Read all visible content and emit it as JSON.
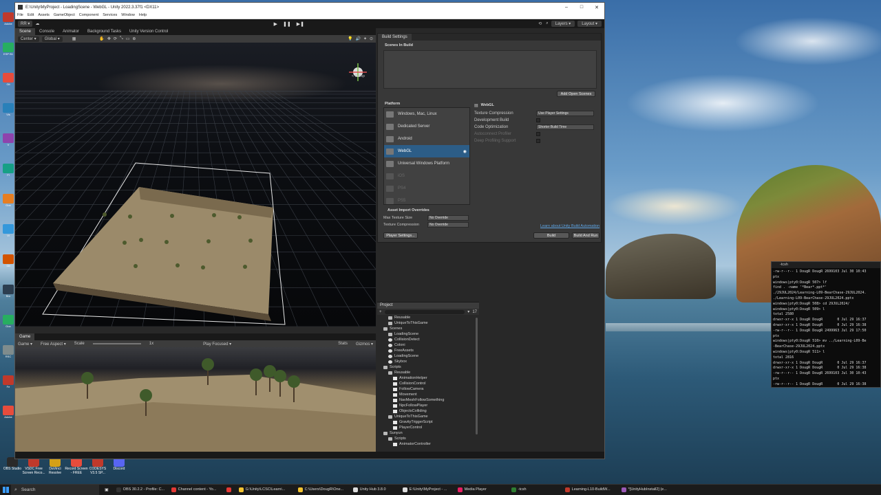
{
  "desktop": {
    "side_icons": [
      "Adobe",
      "ESP B1",
      "Git",
      "Vis",
      "V",
      "Fi",
      "Goo",
      "Vi",
      "Git",
      "Bro",
      "Goo",
      "RSC",
      "Fe",
      "Adobe"
    ],
    "bottom_icons": [
      {
        "label": "OBS Studio",
        "color": "#2a2a2a"
      },
      {
        "label": "VSDC Free Screen Reco...",
        "color": "#c0392b"
      },
      {
        "label": "DaVinci Resolve",
        "color": "#d4a017"
      },
      {
        "label": "Record Screen - FREE",
        "color": "#e74c3c"
      },
      {
        "label": "CODESYS V3.5 SP...",
        "color": "#c0392b"
      },
      {
        "label": "Discord",
        "color": "#5865f2"
      }
    ]
  },
  "unity": {
    "title": "E:\\Unity\\MyProject - LoadingScene - WebGL - Unity 2022.3.37f1 <DX11>",
    "window_controls": [
      "–",
      "□",
      "✕"
    ],
    "menu": [
      "File",
      "Edit",
      "Assets",
      "GameObject",
      "Component",
      "Services",
      "Window",
      "Help"
    ],
    "toolbar": {
      "account": "RR ▾",
      "layers": "Layers ▾",
      "layout": "Layout ▾"
    },
    "scene_tabs": [
      "Scene",
      "Console",
      "Animator",
      "Background Tasks",
      "Unity Version Control"
    ],
    "scene_tools": [
      "Center ▾",
      "Global ▾"
    ],
    "persp_label": "< Persp",
    "game": {
      "tab": "Game",
      "display": "Game ▾",
      "aspect": "Free Aspect ▾",
      "scale_label": "Scale",
      "scale_value": "1x",
      "play_focused": "Play Focused ▾",
      "stats": "Stats",
      "gizmos": "Gizmos ▾"
    },
    "build": {
      "tab": "Build Settings",
      "scenes_in_build": "Scenes In Build",
      "add_open_scenes": "Add Open Scenes",
      "platform_header": "Platform",
      "platforms": [
        {
          "label": "Windows, Mac, Linux",
          "state": "normal"
        },
        {
          "label": "Dedicated Server",
          "state": "normal"
        },
        {
          "label": "Android",
          "state": "normal"
        },
        {
          "label": "WebGL",
          "state": "selected"
        },
        {
          "label": "Universal Windows Platform",
          "state": "normal"
        },
        {
          "label": "iOS",
          "state": "dim"
        },
        {
          "label": "PS4",
          "state": "dim"
        },
        {
          "label": "PS5",
          "state": "dim"
        }
      ],
      "webgl_header": "WebGL",
      "settings": [
        {
          "key": "Texture Compression",
          "value": "Use Player Settings",
          "type": "dropdown"
        },
        {
          "key": "Development Build",
          "value": "",
          "type": "check"
        },
        {
          "key": "Code Optimization",
          "value": "Shorter Build Time",
          "type": "dropdown"
        },
        {
          "key": "Autoconnect Profiler",
          "value": "",
          "type": "check-dim"
        },
        {
          "key": "Deep Profiling Support",
          "value": "",
          "type": "check-dim"
        }
      ],
      "asset_import_overrides": "Asset Import Overrides",
      "max_texture_size": {
        "key": "Max Texture Size",
        "value": "No Override"
      },
      "texture_compression": {
        "key": "Texture Compression",
        "value": "No Override"
      },
      "learn_link": "Learn about Unity Build Automation",
      "player_settings": "Player Settings...",
      "build": "Build",
      "build_and_run": "Build And Run"
    },
    "project": {
      "tab": "Project",
      "count": "17",
      "tree": [
        {
          "label": "Reusable",
          "indent": 2,
          "kind": "folder"
        },
        {
          "label": "UniqueToThisGame",
          "indent": 2,
          "kind": "folder"
        },
        {
          "label": "Scenes",
          "indent": 1,
          "kind": "folder"
        },
        {
          "label": "LoadingScene",
          "indent": 2,
          "kind": "folder"
        },
        {
          "label": "CollisionDetect",
          "indent": 2,
          "kind": "scene"
        },
        {
          "label": "Coloni",
          "indent": 2,
          "kind": "scene"
        },
        {
          "label": "FreeAssets",
          "indent": 2,
          "kind": "scene"
        },
        {
          "label": "LoadingScene",
          "indent": 2,
          "kind": "scene"
        },
        {
          "label": "Skybox",
          "indent": 2,
          "kind": "scene"
        },
        {
          "label": "Scripts",
          "indent": 1,
          "kind": "folder"
        },
        {
          "label": "Reusable",
          "indent": 2,
          "kind": "folder"
        },
        {
          "label": "AnimationHelper",
          "indent": 3,
          "kind": "script"
        },
        {
          "label": "CollisionControl",
          "indent": 3,
          "kind": "script"
        },
        {
          "label": "FollowCamera",
          "indent": 3,
          "kind": "script"
        },
        {
          "label": "Movement",
          "indent": 3,
          "kind": "script"
        },
        {
          "label": "NavMeshFollowSomething",
          "indent": 3,
          "kind": "script"
        },
        {
          "label": "NpcFollowPlayer",
          "indent": 3,
          "kind": "script"
        },
        {
          "label": "ObjectsColliding",
          "indent": 3,
          "kind": "script"
        },
        {
          "label": "UniqueToThisGame",
          "indent": 2,
          "kind": "folder"
        },
        {
          "label": "GravityTriggerScript",
          "indent": 3,
          "kind": "script"
        },
        {
          "label": "PlayerControl",
          "indent": 3,
          "kind": "script"
        },
        {
          "label": "Sunyun",
          "indent": 1,
          "kind": "folder"
        },
        {
          "label": "Scripts",
          "indent": 2,
          "kind": "folder"
        },
        {
          "label": "AnimatorController",
          "indent": 3,
          "kind": "script"
        }
      ]
    }
  },
  "terminal": {
    "title": "-tcsh",
    "lines": [
      "-rw-r--r-- 1 DougR DougR 2699103 Jul 30 10:43",
      "ptx",
      "windows|pty0:DougR 507> lf",
      "find . -name '*Bear*.ppt*'",
      "./29JUL2024/Learning-L09-BearChase-29JUL2024.",
      "./Learning-L09-BearChase-29JUL2024.pptx",
      "windows|pty0:DougR 508> cd 29JUL2024/",
      "windows|pty0:DougR 509> l",
      "total 2580",
      "drwxr-xr-x 1 DougR DougR       0 Jul 29 16:37",
      "drwxr-xr-x 1 DougR DougR       0 Jul 29 16:38",
      "-rw-r--r-- 1 DougR DougR 2499963 Jul 29 17:50",
      "ptx",
      "windows|pty0:DougR 510> mv ../Learning-L09-Be",
      "-BearChase-29JUL2024.pptx",
      "windows|pty0:DougR 511> l",
      "total 2816",
      "drwxr-xr-x 1 DougR DougR       0 Jul 29 16:37",
      "drwxr-xr-x 1 DougR DougR       0 Jul 29 16:38",
      "-rw-r--r-- 1 DougR DougR 2699103 Jul 30 10:43",
      "ptx",
      "-rw-r--r-- 1 DougR DougR       0 Jul 29 16:38",
      "windows|pty0:DougR 512>"
    ]
  },
  "taskbar": {
    "search": "Search",
    "items": [
      {
        "label": "OBS 30.2.2 - Profile: C...",
        "color": "#333"
      },
      {
        "label": "Channel content - Yo...",
        "color": "#e53935"
      },
      {
        "label": "",
        "color": "#e53935"
      },
      {
        "label": "G:\\Unity\\LCSC\\Learni...",
        "color": "#f4c430"
      },
      {
        "label": "C:\\Users\\DougR\\One...",
        "color": "#f4c430"
      },
      {
        "label": "Unity Hub 3.8.0",
        "color": "#ddd"
      },
      {
        "label": "E:\\Unity\\MyProject - ...",
        "color": "#ddd"
      },
      {
        "label": "Media Player",
        "color": "#e91e63"
      },
      {
        "label": "-tcsh",
        "color": "#2e7d32"
      },
      {
        "label": "Learning-L10-BuildW...",
        "color": "#c0392b"
      },
      {
        "label": "*[UnityHubInstall2] (e...",
        "color": "#9b59b6"
      }
    ]
  }
}
